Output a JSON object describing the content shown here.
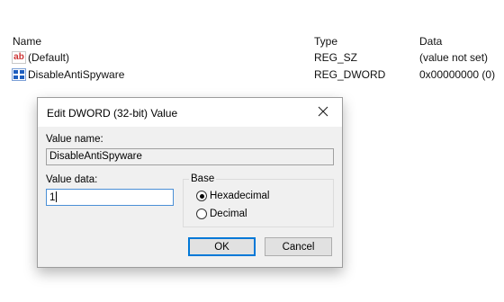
{
  "list": {
    "headers": {
      "name": "Name",
      "type": "Type",
      "data": "Data"
    },
    "rows": [
      {
        "name": "(Default)",
        "type": "REG_SZ",
        "data": "(value not set)",
        "icon": "string-value-icon"
      },
      {
        "name": "DisableAntiSpyware",
        "type": "REG_DWORD",
        "data": "0x00000000 (0)",
        "icon": "binary-value-icon"
      }
    ]
  },
  "dialog": {
    "title": "Edit DWORD (32-bit) Value",
    "value_name_label": "Value name:",
    "value_name": "DisableAntiSpyware",
    "value_data_label": "Value data:",
    "value_data": "1",
    "base_label": "Base",
    "base_options": [
      {
        "label": "Hexadecimal",
        "checked": true
      },
      {
        "label": "Decimal",
        "checked": false
      }
    ],
    "ok_label": "OK",
    "cancel_label": "Cancel",
    "icons": {
      "close": "close-icon"
    }
  },
  "colors": {
    "accent": "#0078d7",
    "dialog_bg": "#f0f0f0",
    "icon_red": "#cc3333",
    "icon_blue": "#1f5fbf"
  }
}
